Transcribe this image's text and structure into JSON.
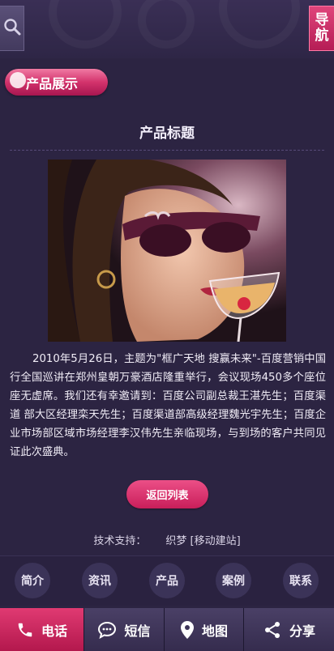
{
  "header": {
    "search_icon": "search-icon",
    "nav_label_line1": "导",
    "nav_label_line2": "航"
  },
  "section": {
    "tag_label": "产品展示"
  },
  "product": {
    "title": "产品标题",
    "image_alt": "product-photo",
    "description": "2010年5月26日，主题为\"框广天地 搜赢未来\"-百度营销中国行全国巡讲在郑州皇朝万豪酒店隆重举行，会议现场450多个座位座无虚席。我们还有幸邀请到：百度公司副总裁王湛先生；百度渠道 部大区经理栾天先生；百度渠道部高级经理魏光宇先生；百度企业市场部区域市场经理李汉伟先生亲临现场，与到场的客户共同见证此次盛典。",
    "back_label": "返回列表"
  },
  "footer": {
    "support_label": "技术支持：",
    "support_value": "织梦 [移动建站]"
  },
  "quicknav": [
    {
      "label": "简介"
    },
    {
      "label": "资讯"
    },
    {
      "label": "产品"
    },
    {
      "label": "案例"
    },
    {
      "label": "联系"
    }
  ],
  "bottombar": [
    {
      "label": "电话",
      "icon": "phone-icon"
    },
    {
      "label": "短信",
      "icon": "chat-icon"
    },
    {
      "label": "地图",
      "icon": "map-pin-icon"
    },
    {
      "label": "分享",
      "icon": "share-icon"
    }
  ],
  "colors": {
    "background": "#2c2442",
    "accent": "#d3336c",
    "bar": "#352c4e"
  }
}
